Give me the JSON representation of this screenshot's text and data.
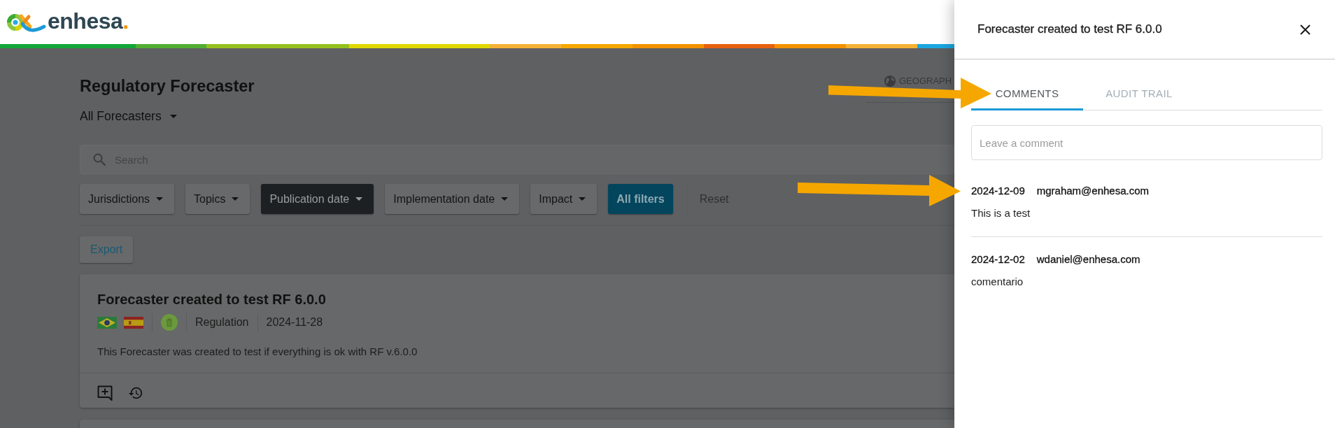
{
  "header": {
    "logo": {
      "name": "enhesa",
      "dot": "."
    }
  },
  "page": {
    "title": "Regulatory Forecaster",
    "view_selector": "All Forecasters",
    "geography_tab": "GEOGRAPH",
    "search": {
      "placeholder": "Search"
    },
    "filters": [
      {
        "label": "Jurisdictions",
        "selected": false
      },
      {
        "label": "Topics",
        "selected": false
      },
      {
        "label": "Publication date",
        "selected": true
      },
      {
        "label": "Implementation date",
        "selected": false
      },
      {
        "label": "Impact",
        "selected": false
      }
    ],
    "all_filters_button": "All filters",
    "reset_button": {
      "label": "Reset",
      "disabled": true
    },
    "export_button": "Export",
    "forecasts": [
      {
        "title": "Forecaster created to test RF 6.0.0",
        "type": "Regulation",
        "date": "2024-11-28",
        "description": "This Forecaster was created to test if everything is ok with RF v.6.0.0"
      }
    ]
  },
  "panel": {
    "title": "Forecaster created to test RF 6.0.0",
    "tabs": [
      {
        "label": "COMMENTS",
        "selected": true
      },
      {
        "label": "AUDIT TRAIL",
        "selected": false
      }
    ],
    "comment_field": {
      "placeholder": "Leave a comment"
    },
    "comments": [
      {
        "date": "2024-12-09",
        "author": "mgraham@enhesa.com",
        "text": "This is a test"
      },
      {
        "date": "2024-12-02",
        "author": "wdaniel@enhesa.com",
        "text": "comentario"
      }
    ]
  }
}
